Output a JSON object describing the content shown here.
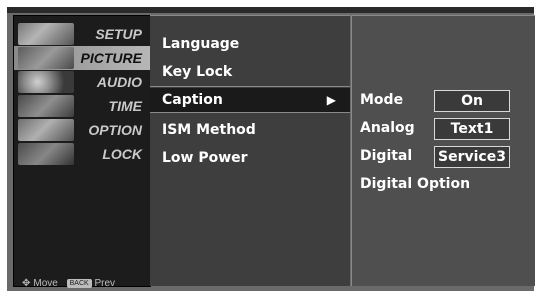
{
  "left_menu": {
    "items": [
      {
        "label": "SETUP",
        "icon": "satellite-dish-icon"
      },
      {
        "label": "PICTURE",
        "icon": "film-strip-icon"
      },
      {
        "label": "AUDIO",
        "icon": "speaker-icon"
      },
      {
        "label": "TIME",
        "icon": "clock-icon"
      },
      {
        "label": "OPTION",
        "icon": "option-tag-icon"
      },
      {
        "label": "LOCK",
        "icon": "padlock-icon"
      }
    ],
    "hint_move": "Move",
    "hint_back_key": "BACK",
    "hint_prev": "Prev"
  },
  "option_menu": {
    "items": [
      "Language",
      "Key Lock",
      "Caption",
      "ISM Method",
      "Low Power"
    ],
    "selected": "Caption"
  },
  "caption_menu": {
    "mode_label": "Mode",
    "mode_value": "On",
    "analog_label": "Analog",
    "analog_value": "Text1",
    "digital_label": "Digital",
    "digital_value": "Service3",
    "digital_option_label": "Digital Option"
  },
  "colors": {
    "left_bg": "#1c1c1c",
    "middle_bg": "#3e3e3e",
    "right_bg": "#4f4f4f",
    "text": "#ffffff"
  }
}
